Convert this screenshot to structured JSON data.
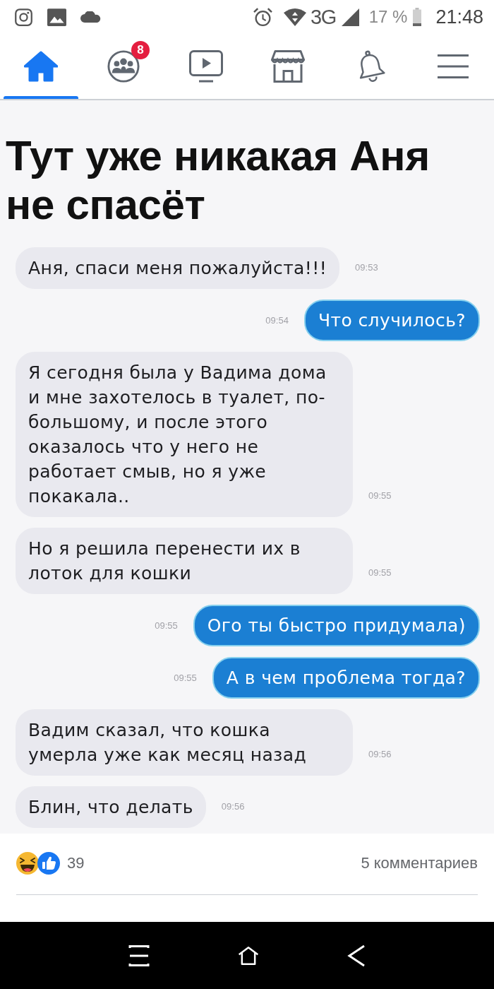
{
  "status_bar": {
    "network": "3G",
    "battery": "17 %",
    "time": "21:48"
  },
  "nav_tabs": [
    {
      "kind": "home",
      "selected": true
    },
    {
      "kind": "groups",
      "selected": false,
      "badge": "8"
    },
    {
      "kind": "video",
      "selected": false
    },
    {
      "kind": "marketplace",
      "selected": false
    },
    {
      "kind": "notifications",
      "selected": false
    },
    {
      "kind": "menu",
      "selected": false
    }
  ],
  "post": {
    "image": {
      "caption": "Тут уже никакая Аня не спасёт",
      "messages": [
        {
          "kind": "incoming",
          "text": "Аня, спаси меня пожалуйста!!!",
          "time": "09:53"
        },
        {
          "kind": "outgoing",
          "text": "Что случилось?",
          "time": "09:54"
        },
        {
          "kind": "incoming",
          "text": "Я сегодня была у Вадима дома и мне захотелось в туалет, по-большому, и после этого оказалось что у него не работает смыв, но я уже покакала..",
          "time": "09:55"
        },
        {
          "kind": "incoming",
          "text": "Но я решила перенести их в лоток для кошки",
          "time": "09:55"
        },
        {
          "kind": "outgoing",
          "text": "Ого ты быстро придумала)",
          "time": "09:55"
        },
        {
          "kind": "outgoing",
          "text": "А в чем проблема тогда?",
          "time": "09:55"
        },
        {
          "kind": "incoming",
          "text": "Вадим сказал, что кошка умерла уже как месяц назад",
          "time": "09:56"
        },
        {
          "kind": "incoming",
          "text": "Блин, что делать",
          "time": "09:56"
        }
      ]
    },
    "reactions_count": "39",
    "comments_count": "5 комментариев"
  }
}
